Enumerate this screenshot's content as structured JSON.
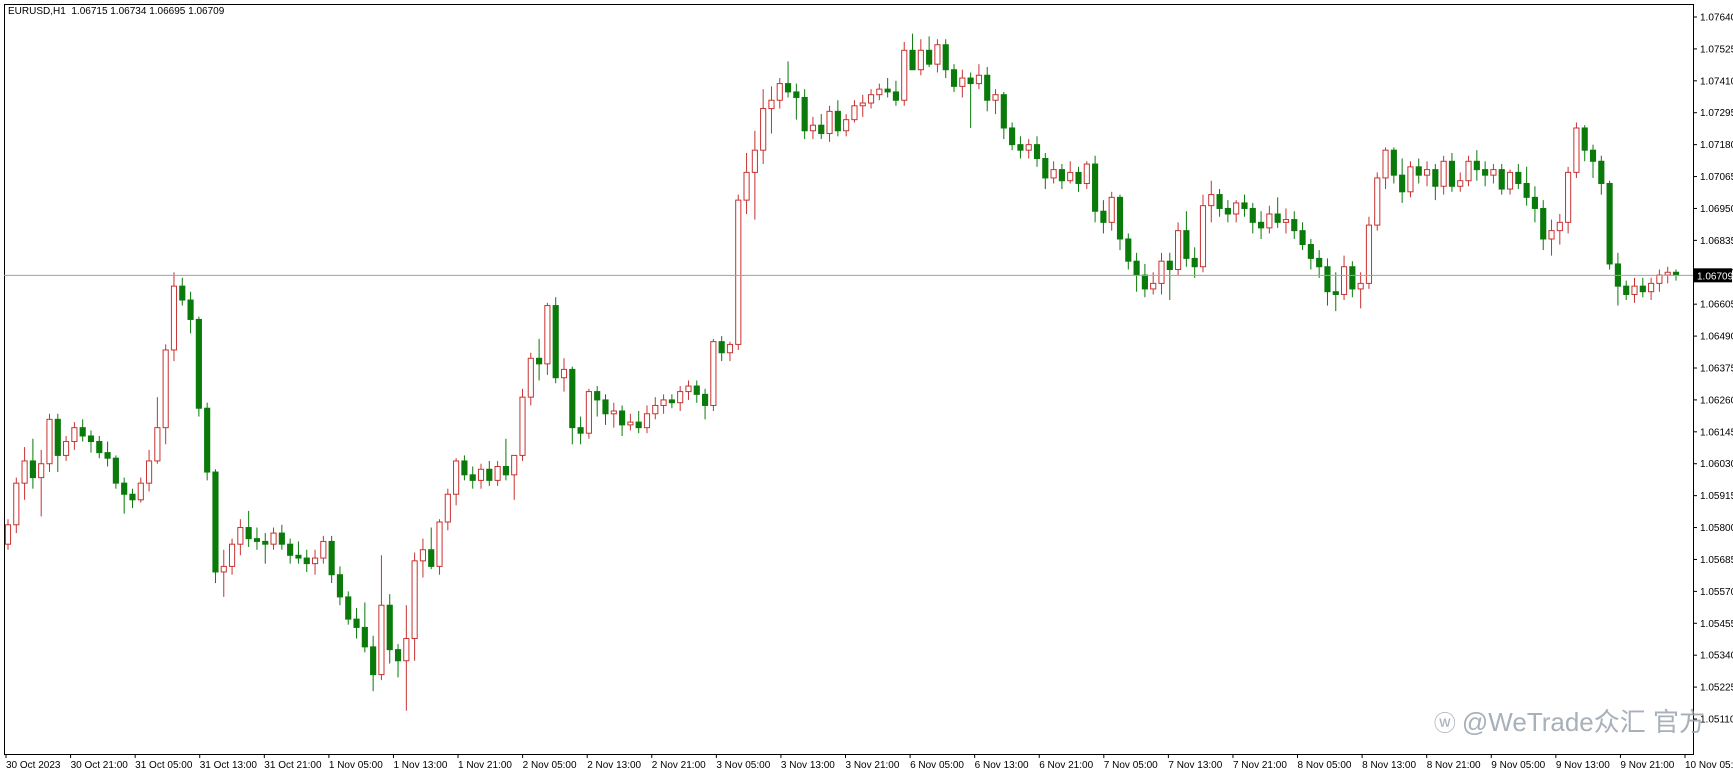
{
  "header": {
    "symbol": "EURUSD,H1",
    "quote": "1.06715 1.06734 1.06695 1.06709"
  },
  "watermark": {
    "icon": "weibo-logo-icon",
    "text": "@WeTrade众汇 官方"
  },
  "colors": {
    "bull": "#c83232",
    "bear": "#0a7a0a",
    "axis": "#000000",
    "price_line": "#a0a0a0",
    "price_label_bg": "#000000",
    "price_label_fg": "#ffffff"
  },
  "chart_data": {
    "type": "candlestick",
    "symbol": "EURUSD",
    "timeframe": "H1",
    "ylim": [
      1.0511,
      1.0764
    ],
    "y_ticks": [
      "1.07640",
      "1.07525",
      "1.07410",
      "1.07295",
      "1.07180",
      "1.07065",
      "1.06950",
      "1.06835",
      "1.06720",
      "1.06605",
      "1.06490",
      "1.06375",
      "1.06260",
      "1.06145",
      "1.06030",
      "1.05915",
      "1.05800",
      "1.05685",
      "1.05570",
      "1.05455",
      "1.05340",
      "1.05225",
      "1.05110"
    ],
    "x_ticks": [
      "30 Oct 2023",
      "30 Oct 21:00",
      "31 Oct 05:00",
      "31 Oct 13:00",
      "31 Oct 21:00",
      "1 Nov 05:00",
      "1 Nov 13:00",
      "1 Nov 21:00",
      "2 Nov 05:00",
      "2 Nov 13:00",
      "2 Nov 21:00",
      "3 Nov 05:00",
      "3 Nov 13:00",
      "3 Nov 21:00",
      "6 Nov 05:00",
      "6 Nov 13:00",
      "6 Nov 21:00",
      "7 Nov 05:00",
      "7 Nov 13:00",
      "7 Nov 21:00",
      "8 Nov 05:00",
      "8 Nov 13:00",
      "8 Nov 21:00",
      "9 Nov 05:00",
      "9 Nov 13:00",
      "9 Nov 21:00",
      "10 Nov 05:00"
    ],
    "current_price": "1.06709",
    "current_price_value": 1.06709,
    "candles": [
      [
        1.0574,
        1.0583,
        1.0572,
        1.0581
      ],
      [
        1.0581,
        1.0598,
        1.0578,
        1.0596
      ],
      [
        1.0596,
        1.0609,
        1.059,
        1.0604
      ],
      [
        1.0604,
        1.0612,
        1.0594,
        1.0598
      ],
      [
        1.0598,
        1.0608,
        1.0584,
        1.0603
      ],
      [
        1.0603,
        1.0621,
        1.06,
        1.0619
      ],
      [
        1.0619,
        1.0621,
        1.06,
        1.0606
      ],
      [
        1.0606,
        1.0613,
        1.0604,
        1.0611
      ],
      [
        1.0611,
        1.0618,
        1.0608,
        1.0616
      ],
      [
        1.0616,
        1.0619,
        1.0611,
        1.0613
      ],
      [
        1.0613,
        1.0615,
        1.0607,
        1.0611
      ],
      [
        1.0611,
        1.0613,
        1.0605,
        1.0607
      ],
      [
        1.0607,
        1.0611,
        1.0602,
        1.0605
      ],
      [
        1.0605,
        1.0606,
        1.0594,
        1.0596
      ],
      [
        1.0596,
        1.0598,
        1.0585,
        1.0592
      ],
      [
        1.0592,
        1.0594,
        1.0587,
        1.059
      ],
      [
        1.059,
        1.0598,
        1.0589,
        1.0596
      ],
      [
        1.0596,
        1.0608,
        1.0593,
        1.0604
      ],
      [
        1.0604,
        1.0627,
        1.0603,
        1.0616
      ],
      [
        1.0616,
        1.0646,
        1.061,
        1.0644
      ],
      [
        1.0644,
        1.0672,
        1.064,
        1.0667
      ],
      [
        1.0667,
        1.067,
        1.066,
        1.0662
      ],
      [
        1.0662,
        1.0665,
        1.065,
        1.0655
      ],
      [
        1.0655,
        1.0656,
        1.062,
        1.0623
      ],
      [
        1.0623,
        1.0625,
        1.0597,
        1.06
      ],
      [
        1.06,
        1.0601,
        1.056,
        1.0564
      ],
      [
        1.0564,
        1.0572,
        1.0555,
        1.0566
      ],
      [
        1.0566,
        1.0576,
        1.0563,
        1.0574
      ],
      [
        1.0574,
        1.0583,
        1.057,
        1.058
      ],
      [
        1.058,
        1.0586,
        1.0573,
        1.0576
      ],
      [
        1.0576,
        1.058,
        1.0572,
        1.0575
      ],
      [
        1.0575,
        1.0578,
        1.0567,
        1.0574
      ],
      [
        1.0574,
        1.058,
        1.0572,
        1.0578
      ],
      [
        1.0578,
        1.0581,
        1.0572,
        1.0574
      ],
      [
        1.0574,
        1.0576,
        1.0567,
        1.057
      ],
      [
        1.057,
        1.0575,
        1.0567,
        1.0569
      ],
      [
        1.0569,
        1.0572,
        1.0564,
        1.0567
      ],
      [
        1.0567,
        1.0572,
        1.0563,
        1.0569
      ],
      [
        1.0569,
        1.0577,
        1.0567,
        1.0575
      ],
      [
        1.0575,
        1.0577,
        1.056,
        1.0563
      ],
      [
        1.0563,
        1.0566,
        1.0552,
        1.0555
      ],
      [
        1.0555,
        1.0557,
        1.0545,
        1.0547
      ],
      [
        1.0547,
        1.0551,
        1.054,
        1.0544
      ],
      [
        1.0544,
        1.0553,
        1.0535,
        1.0537
      ],
      [
        1.0537,
        1.0541,
        1.0521,
        1.0527
      ],
      [
        1.0527,
        1.057,
        1.0525,
        1.0552
      ],
      [
        1.0552,
        1.0556,
        1.0531,
        1.0536
      ],
      [
        1.0536,
        1.0538,
        1.0526,
        1.0532
      ],
      [
        1.0532,
        1.0552,
        1.0514,
        1.054
      ],
      [
        1.054,
        1.0571,
        1.0532,
        1.0568
      ],
      [
        1.0568,
        1.0576,
        1.0562,
        1.0572
      ],
      [
        1.0572,
        1.058,
        1.0565,
        1.0566
      ],
      [
        1.0566,
        1.0583,
        1.0563,
        1.0582
      ],
      [
        1.0582,
        1.0594,
        1.0579,
        1.0592
      ],
      [
        1.0592,
        1.0605,
        1.0588,
        1.0604
      ],
      [
        1.0604,
        1.0606,
        1.0597,
        1.0599
      ],
      [
        1.0599,
        1.0602,
        1.0594,
        1.0597
      ],
      [
        1.0597,
        1.0603,
        1.0594,
        1.0601
      ],
      [
        1.0601,
        1.0604,
        1.0595,
        1.0597
      ],
      [
        1.0597,
        1.0604,
        1.0595,
        1.0602
      ],
      [
        1.0602,
        1.0612,
        1.0597,
        1.0599
      ],
      [
        1.0599,
        1.0606,
        1.059,
        1.0606
      ],
      [
        1.0606,
        1.063,
        1.0604,
        1.0627
      ],
      [
        1.0627,
        1.0643,
        1.0624,
        1.0641
      ],
      [
        1.0641,
        1.0648,
        1.0633,
        1.0639
      ],
      [
        1.0639,
        1.0661,
        1.0635,
        1.066
      ],
      [
        1.066,
        1.0663,
        1.0632,
        1.0634
      ],
      [
        1.0634,
        1.0641,
        1.0629,
        1.0637
      ],
      [
        1.0637,
        1.0638,
        1.061,
        1.0616
      ],
      [
        1.0616,
        1.062,
        1.061,
        1.0614
      ],
      [
        1.0614,
        1.063,
        1.0612,
        1.0629
      ],
      [
        1.0629,
        1.0631,
        1.062,
        1.0626
      ],
      [
        1.0626,
        1.0628,
        1.0617,
        1.0621
      ],
      [
        1.0621,
        1.0625,
        1.0616,
        1.0622
      ],
      [
        1.0622,
        1.0624,
        1.0613,
        1.0617
      ],
      [
        1.0617,
        1.0621,
        1.0615,
        1.0618
      ],
      [
        1.0618,
        1.0622,
        1.0614,
        1.0616
      ],
      [
        1.0616,
        1.0624,
        1.0614,
        1.0621
      ],
      [
        1.0621,
        1.0627,
        1.0619,
        1.0624
      ],
      [
        1.0624,
        1.0628,
        1.0621,
        1.0626
      ],
      [
        1.0626,
        1.0628,
        1.0623,
        1.0625
      ],
      [
        1.0625,
        1.0631,
        1.0622,
        1.0629
      ],
      [
        1.0629,
        1.0633,
        1.0626,
        1.0631
      ],
      [
        1.0631,
        1.0633,
        1.0625,
        1.0628
      ],
      [
        1.0628,
        1.063,
        1.0619,
        1.0624
      ],
      [
        1.0624,
        1.0648,
        1.0622,
        1.0647
      ],
      [
        1.0647,
        1.0649,
        1.064,
        1.0643
      ],
      [
        1.0643,
        1.0647,
        1.064,
        1.0646
      ],
      [
        1.0646,
        1.07,
        1.0644,
        1.0698
      ],
      [
        1.0698,
        1.0715,
        1.0693,
        1.0708
      ],
      [
        1.0708,
        1.0723,
        1.0691,
        1.0716
      ],
      [
        1.0716,
        1.0738,
        1.0711,
        1.0731
      ],
      [
        1.0731,
        1.0739,
        1.0722,
        1.0734
      ],
      [
        1.0734,
        1.0742,
        1.0731,
        1.074
      ],
      [
        1.074,
        1.0748,
        1.0735,
        1.0737
      ],
      [
        1.0737,
        1.074,
        1.0727,
        1.0735
      ],
      [
        1.0735,
        1.0738,
        1.072,
        1.0723
      ],
      [
        1.0723,
        1.0728,
        1.072,
        1.0725
      ],
      [
        1.0725,
        1.0729,
        1.072,
        1.0722
      ],
      [
        1.0722,
        1.0732,
        1.0719,
        1.073
      ],
      [
        1.073,
        1.0734,
        1.0721,
        1.0723
      ],
      [
        1.0723,
        1.0729,
        1.0721,
        1.0727
      ],
      [
        1.0727,
        1.0734,
        1.0726,
        1.0732
      ],
      [
        1.0732,
        1.0736,
        1.0728,
        1.0733
      ],
      [
        1.0733,
        1.0738,
        1.0731,
        1.0736
      ],
      [
        1.0736,
        1.074,
        1.0734,
        1.0738
      ],
      [
        1.0738,
        1.0742,
        1.0735,
        1.0737
      ],
      [
        1.0737,
        1.0741,
        1.0732,
        1.0734
      ],
      [
        1.0734,
        1.0755,
        1.0732,
        1.0752
      ],
      [
        1.0752,
        1.0758,
        1.0745,
        1.0745
      ],
      [
        1.0745,
        1.0756,
        1.0743,
        1.0752
      ],
      [
        1.0752,
        1.0757,
        1.0746,
        1.0747
      ],
      [
        1.0747,
        1.0756,
        1.0744,
        1.0754
      ],
      [
        1.0754,
        1.0756,
        1.0742,
        1.0745
      ],
      [
        1.0745,
        1.0747,
        1.0737,
        1.0739
      ],
      [
        1.0739,
        1.0745,
        1.0735,
        1.0742
      ],
      [
        1.0742,
        1.0744,
        1.0724,
        1.074
      ],
      [
        1.074,
        1.0747,
        1.0738,
        1.0743
      ],
      [
        1.0743,
        1.0746,
        1.073,
        1.0734
      ],
      [
        1.0734,
        1.0738,
        1.0729,
        1.0736
      ],
      [
        1.0736,
        1.0737,
        1.072,
        1.0724
      ],
      [
        1.0724,
        1.0726,
        1.0716,
        1.0718
      ],
      [
        1.0718,
        1.0721,
        1.0713,
        1.0716
      ],
      [
        1.0716,
        1.072,
        1.0713,
        1.0718
      ],
      [
        1.0718,
        1.0721,
        1.071,
        1.0713
      ],
      [
        1.0713,
        1.0715,
        1.0702,
        1.0706
      ],
      [
        1.0706,
        1.0712,
        1.0704,
        1.0709
      ],
      [
        1.0709,
        1.0711,
        1.0702,
        1.0705
      ],
      [
        1.0705,
        1.0712,
        1.0704,
        1.0708
      ],
      [
        1.0708,
        1.071,
        1.0701,
        1.0704
      ],
      [
        1.0704,
        1.0712,
        1.0702,
        1.0711
      ],
      [
        1.0711,
        1.0714,
        1.069,
        1.0694
      ],
      [
        1.0694,
        1.0698,
        1.0686,
        1.069
      ],
      [
        1.069,
        1.0701,
        1.0687,
        1.0699
      ],
      [
        1.0699,
        1.07,
        1.068,
        1.0684
      ],
      [
        1.0684,
        1.0686,
        1.0673,
        1.0676
      ],
      [
        1.0676,
        1.0679,
        1.0665,
        1.0671
      ],
      [
        1.0671,
        1.0675,
        1.0663,
        1.0666
      ],
      [
        1.0666,
        1.0672,
        1.0664,
        1.0668
      ],
      [
        1.0668,
        1.0679,
        1.0664,
        1.0676
      ],
      [
        1.0676,
        1.0679,
        1.0662,
        1.0673
      ],
      [
        1.0673,
        1.069,
        1.0671,
        1.0687
      ],
      [
        1.0687,
        1.0694,
        1.0674,
        1.0677
      ],
      [
        1.0677,
        1.0681,
        1.067,
        1.0674
      ],
      [
        1.0674,
        1.07,
        1.0672,
        1.0696
      ],
      [
        1.0696,
        1.0705,
        1.069,
        1.07
      ],
      [
        1.07,
        1.0702,
        1.0692,
        1.0695
      ],
      [
        1.0695,
        1.0698,
        1.069,
        1.0693
      ],
      [
        1.0693,
        1.0698,
        1.069,
        1.0697
      ],
      [
        1.0697,
        1.07,
        1.0692,
        1.0695
      ],
      [
        1.0695,
        1.0697,
        1.0686,
        1.069
      ],
      [
        1.069,
        1.0694,
        1.0684,
        1.0688
      ],
      [
        1.0688,
        1.0696,
        1.0686,
        1.0693
      ],
      [
        1.0693,
        1.0699,
        1.0688,
        1.069
      ],
      [
        1.069,
        1.0695,
        1.0686,
        1.0691
      ],
      [
        1.0691,
        1.0694,
        1.0684,
        1.0687
      ],
      [
        1.0687,
        1.069,
        1.068,
        1.0682
      ],
      [
        1.0682,
        1.0684,
        1.0673,
        1.0677
      ],
      [
        1.0677,
        1.068,
        1.067,
        1.0674
      ],
      [
        1.0674,
        1.0677,
        1.066,
        1.0665
      ],
      [
        1.0665,
        1.0672,
        1.0658,
        1.0664
      ],
      [
        1.0664,
        1.0678,
        1.0662,
        1.0674
      ],
      [
        1.0674,
        1.0676,
        1.0663,
        1.0666
      ],
      [
        1.0666,
        1.0672,
        1.0659,
        1.0668
      ],
      [
        1.0668,
        1.0692,
        1.0666,
        1.0689
      ],
      [
        1.0689,
        1.0708,
        1.0687,
        1.0706
      ],
      [
        1.0706,
        1.0717,
        1.0702,
        1.0716
      ],
      [
        1.0716,
        1.0717,
        1.0704,
        1.0707
      ],
      [
        1.0707,
        1.0713,
        1.0697,
        1.0701
      ],
      [
        1.0701,
        1.0712,
        1.0699,
        1.071
      ],
      [
        1.071,
        1.0713,
        1.0704,
        1.0707
      ],
      [
        1.0707,
        1.0712,
        1.0703,
        1.0709
      ],
      [
        1.0709,
        1.0711,
        1.0698,
        1.0703
      ],
      [
        1.0703,
        1.0714,
        1.07,
        1.0712
      ],
      [
        1.0712,
        1.0715,
        1.0701,
        1.0703
      ],
      [
        1.0703,
        1.0708,
        1.0701,
        1.0705
      ],
      [
        1.0705,
        1.0714,
        1.0703,
        1.0712
      ],
      [
        1.0712,
        1.0716,
        1.0705,
        1.0709
      ],
      [
        1.0709,
        1.0712,
        1.0703,
        1.0707
      ],
      [
        1.0707,
        1.0711,
        1.0704,
        1.0709
      ],
      [
        1.0709,
        1.0711,
        1.07,
        1.0702
      ],
      [
        1.0702,
        1.0709,
        1.07,
        1.0708
      ],
      [
        1.0708,
        1.0711,
        1.0702,
        1.0704
      ],
      [
        1.0704,
        1.071,
        1.0696,
        1.0699
      ],
      [
        1.0699,
        1.0703,
        1.069,
        1.0695
      ],
      [
        1.0695,
        1.0698,
        1.068,
        1.0684
      ],
      [
        1.0684,
        1.0691,
        1.0678,
        1.0687
      ],
      [
        1.0687,
        1.0693,
        1.0682,
        1.069
      ],
      [
        1.069,
        1.071,
        1.0686,
        1.0708
      ],
      [
        1.0708,
        1.0726,
        1.0706,
        1.0724
      ],
      [
        1.0724,
        1.0725,
        1.0712,
        1.0716
      ],
      [
        1.0716,
        1.0718,
        1.0706,
        1.0712
      ],
      [
        1.0712,
        1.0714,
        1.07,
        1.0704
      ],
      [
        1.0704,
        1.0705,
        1.0673,
        1.0675
      ],
      [
        1.0675,
        1.0679,
        1.066,
        1.0667
      ],
      [
        1.0667,
        1.0669,
        1.0662,
        1.0664
      ],
      [
        1.0664,
        1.067,
        1.0661,
        1.0667
      ],
      [
        1.0667,
        1.067,
        1.0663,
        1.0665
      ],
      [
        1.0665,
        1.067,
        1.0662,
        1.0668
      ],
      [
        1.0668,
        1.0673,
        1.0665,
        1.0671
      ],
      [
        1.0671,
        1.0674,
        1.0668,
        1.0672
      ],
      [
        1.0672,
        1.0673,
        1.0669,
        1.0671
      ]
    ]
  }
}
